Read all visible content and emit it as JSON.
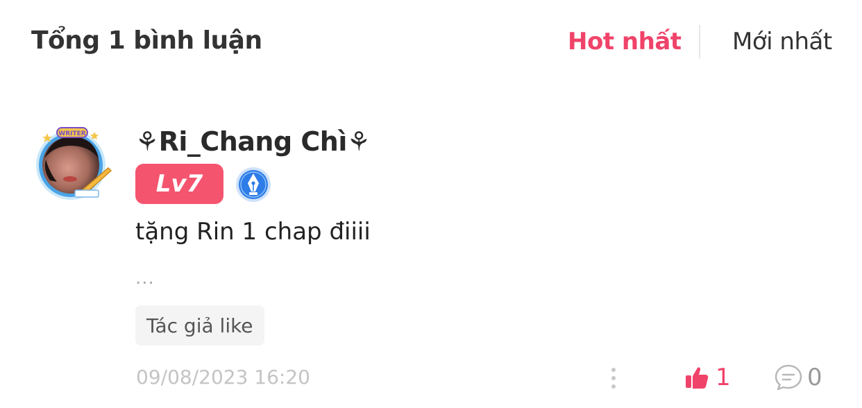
{
  "header": {
    "title": "Tổng 1 bình luận",
    "sort_options": [
      {
        "label": "Hot nhất",
        "active": true
      },
      {
        "label": "Mới nhất",
        "active": false
      }
    ]
  },
  "comment": {
    "avatar_frame_label": "WRITER",
    "username": "⚘Ri_Chang Chì⚘",
    "level": "Lv7",
    "badge_icon": "writer-pen-badge-icon",
    "text": "tặng Rin 1 chap điiii",
    "ellipsis": "...",
    "tag": "Tác giả like",
    "timestamp": "09/08/2023 16:20",
    "likes": "1",
    "replies": "0"
  },
  "colors": {
    "accent": "#f0436a",
    "level_badge": "#f5546f",
    "badge_blue": "#2d7ce8",
    "text_muted": "#c4c4c4"
  }
}
